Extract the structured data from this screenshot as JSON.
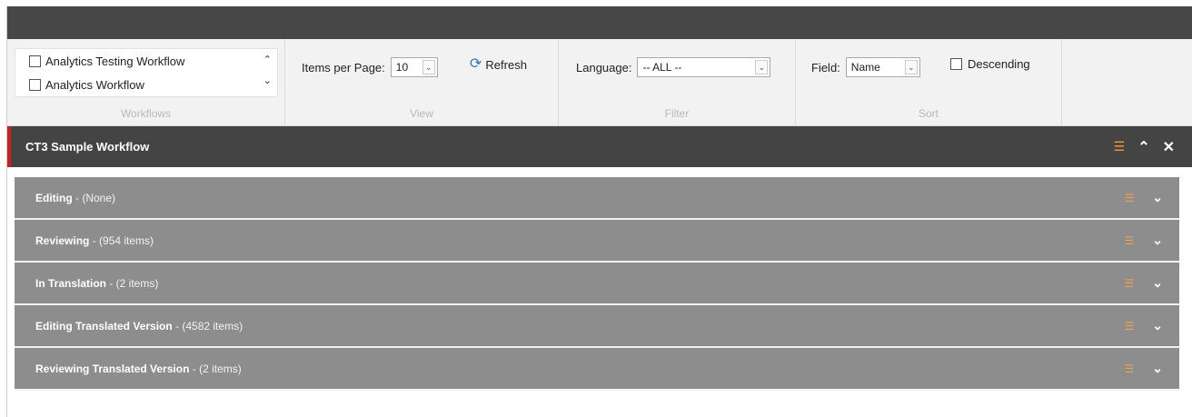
{
  "workflows": {
    "items": [
      {
        "label": "Analytics Testing Workflow",
        "checked": false
      },
      {
        "label": "Analytics Workflow",
        "checked": false
      }
    ],
    "group_label": "Workflows"
  },
  "view": {
    "items_per_page_label": "Items per Page:",
    "items_per_page_value": "10",
    "refresh_label": "Refresh",
    "group_label": "View"
  },
  "filter": {
    "language_label": "Language:",
    "language_value": "-- ALL --",
    "group_label": "Filter"
  },
  "sort": {
    "field_label": "Field:",
    "field_value": "Name",
    "descending_label": "Descending",
    "group_label": "Sort"
  },
  "workflow_panel": {
    "title": "CT3 Sample Workflow",
    "stages": [
      {
        "name": "Editing",
        "count": " - (None)"
      },
      {
        "name": "Reviewing",
        "count": " - (954 items)"
      },
      {
        "name": "In Translation",
        "count": " - (2 items)"
      },
      {
        "name": "Editing Translated Version",
        "count": " - (4582 items)"
      },
      {
        "name": "Reviewing Translated Version",
        "count": " - (2 items)"
      }
    ]
  },
  "icons": {
    "rss": "rss-icon",
    "collapse": "chevron-up-icon",
    "close": "close-icon",
    "expand": "chevron-down-icon",
    "refresh": "refresh-icon"
  },
  "colors": {
    "accent_red": "#cc1f1f",
    "rss_orange": "#f39c2d",
    "stage_bg": "#8d8d8d",
    "header_bg": "#444444"
  }
}
